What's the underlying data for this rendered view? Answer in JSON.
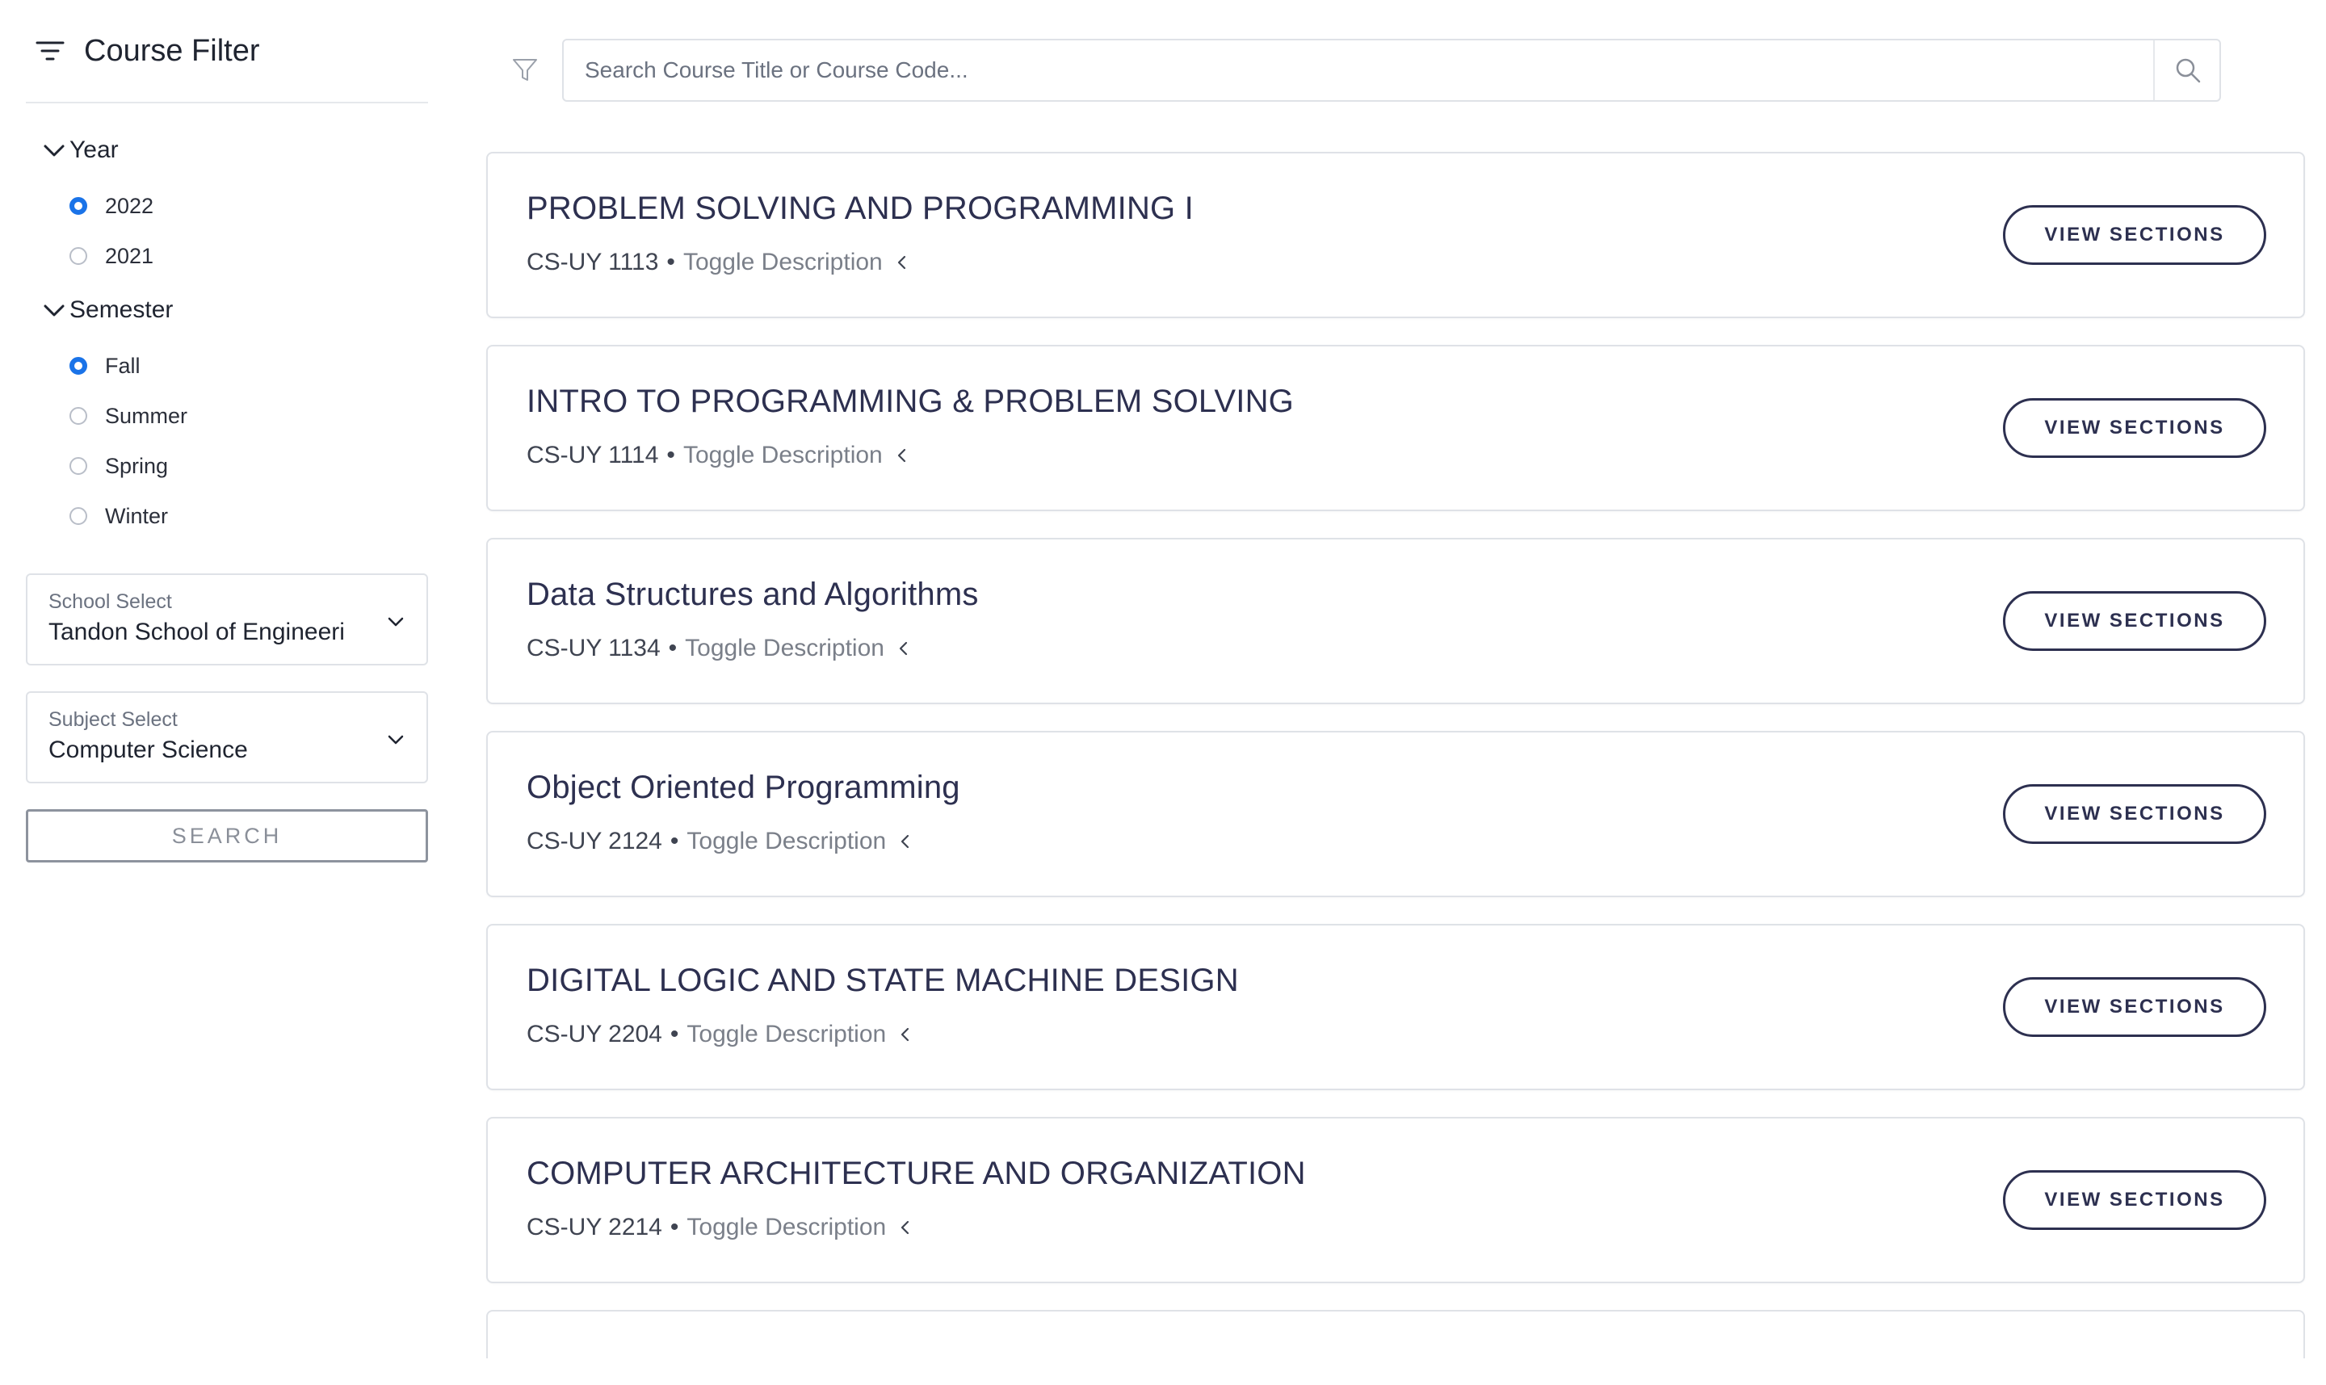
{
  "sidebar": {
    "title": "Course Filter",
    "year": {
      "label": "Year",
      "options": [
        {
          "label": "2022",
          "selected": true
        },
        {
          "label": "2021",
          "selected": false
        }
      ]
    },
    "semester": {
      "label": "Semester",
      "options": [
        {
          "label": "Fall",
          "selected": true
        },
        {
          "label": "Summer",
          "selected": false
        },
        {
          "label": "Spring",
          "selected": false
        },
        {
          "label": "Winter",
          "selected": false
        }
      ]
    },
    "school_select": {
      "label": "School Select",
      "value": "Tandon School of Engineeri"
    },
    "subject_select": {
      "label": "Subject Select",
      "value": "Computer Science"
    },
    "search_label": "SEARCH"
  },
  "search": {
    "placeholder": "Search Course Title or Course Code..."
  },
  "courses": [
    {
      "title": "PROBLEM SOLVING AND PROGRAMMING I",
      "code": "CS-UY 1113",
      "toggle": "Toggle Description",
      "button": "VIEW SECTIONS"
    },
    {
      "title": "INTRO TO PROGRAMMING & PROBLEM SOLVING",
      "code": "CS-UY 1114",
      "toggle": "Toggle Description",
      "button": "VIEW SECTIONS"
    },
    {
      "title": "Data Structures and Algorithms",
      "code": "CS-UY 1134",
      "toggle": "Toggle Description",
      "button": "VIEW SECTIONS"
    },
    {
      "title": "Object Oriented Programming",
      "code": "CS-UY 2124",
      "toggle": "Toggle Description",
      "button": "VIEW SECTIONS"
    },
    {
      "title": "DIGITAL LOGIC AND STATE MACHINE DESIGN",
      "code": "CS-UY 2204",
      "toggle": "Toggle Description",
      "button": "VIEW SECTIONS"
    },
    {
      "title": "COMPUTER ARCHITECTURE AND ORGANIZATION",
      "code": "CS-UY 2214",
      "toggle": "Toggle Description",
      "button": "VIEW SECTIONS"
    }
  ],
  "colors": {
    "accent": "#1a73e8",
    "title_text": "#2d3050",
    "border": "#dfe2e7"
  }
}
